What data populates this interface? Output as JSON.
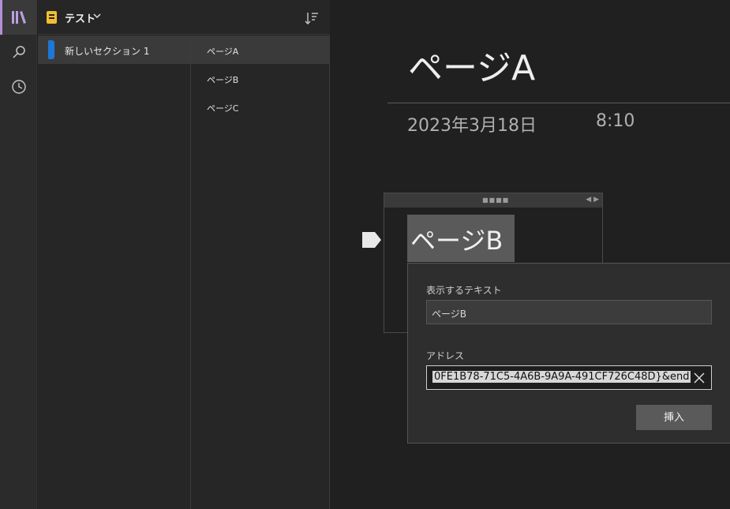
{
  "notebook": {
    "name": "テスト"
  },
  "sections": [
    {
      "label": "新しいセクション 1",
      "color": "#1e78d6"
    }
  ],
  "pages": [
    {
      "label": "ページA",
      "selected": true
    },
    {
      "label": "ページB",
      "selected": false
    },
    {
      "label": "ページC",
      "selected": false
    }
  ],
  "canvas": {
    "title": "ページA",
    "date": "2023年3月18日",
    "time": "8:10",
    "link_text": "ページB"
  },
  "link_dialog": {
    "display_text_label": "表示するテキスト",
    "display_text_value": "ページB",
    "address_label": "アドレス",
    "address_value": "0FE1B78-71C5-4A6B-9A9A-491CF726C48D}&end",
    "insert_label": "挿入"
  },
  "icons": {
    "rail": [
      "notebooks-icon",
      "search-icon",
      "recent-icon"
    ],
    "sort": "sort-icon",
    "clear": "close-icon"
  },
  "colors": {
    "accent": "#b38ed9",
    "notebook": "#f2c02e",
    "section": "#1e78d6"
  }
}
